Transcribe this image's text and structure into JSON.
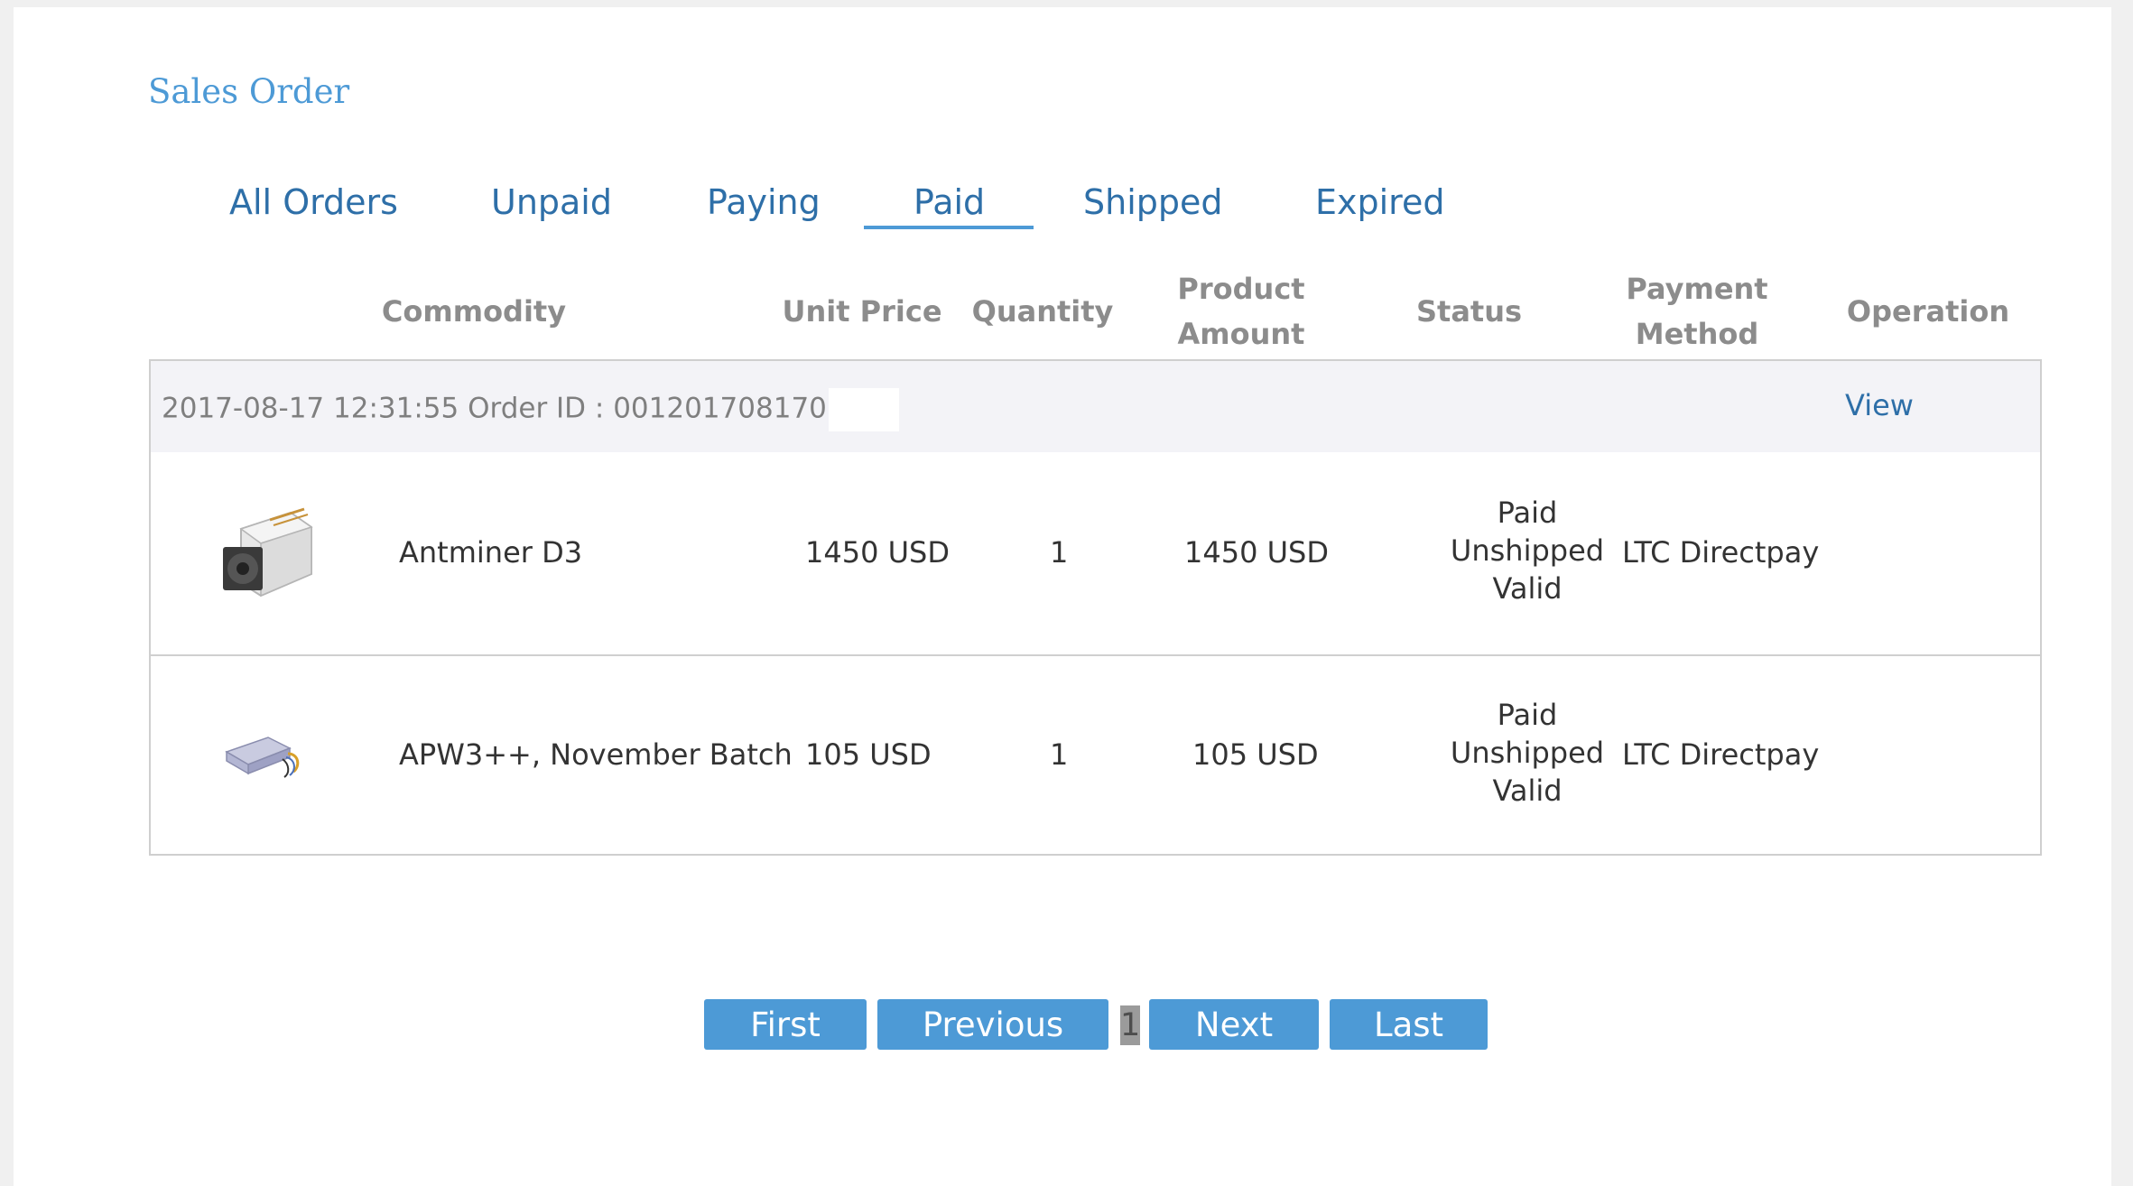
{
  "header": {
    "title": "Sales Order"
  },
  "tabs": [
    {
      "label": "All Orders"
    },
    {
      "label": "Unpaid"
    },
    {
      "label": "Paying"
    },
    {
      "label": "Paid",
      "active": true
    },
    {
      "label": "Shipped"
    },
    {
      "label": "Expired"
    }
  ],
  "columns": {
    "commodity": "Commodity",
    "unit_price": "Unit Price",
    "quantity": "Quantity",
    "product_amount_1": "Product",
    "product_amount_2": "Amount",
    "status": "Status",
    "payment_method_1": "Payment",
    "payment_method_2": "Method",
    "operation": "Operation"
  },
  "order": {
    "info": "2017-08-17 12:31:55 Order ID : 001201708170",
    "view_label": "View",
    "items": [
      {
        "image": "antminer-d3-icon",
        "name": "Antminer D3",
        "unit_price": "1450  USD",
        "quantity": "1",
        "amount": "1450  USD",
        "status": [
          "Paid",
          "Unshipped",
          "Valid"
        ],
        "payment_method": "LTC Directpay"
      },
      {
        "image": "power-supply-icon",
        "name": "APW3++, November Batch",
        "unit_price": "105  USD",
        "quantity": "1",
        "amount": "105  USD",
        "status": [
          "Paid",
          "Unshipped",
          "Valid"
        ],
        "payment_method": "LTC Directpay"
      }
    ]
  },
  "pagination": {
    "first": "First",
    "previous": "Previous",
    "current_page": "1",
    "next": "Next",
    "last": "Last"
  },
  "colors": {
    "accent": "#4d9ad6",
    "tab_text": "#2e6fa8",
    "header_text": "#8c8c8c",
    "row_head_bg": "#f3f3f7"
  }
}
